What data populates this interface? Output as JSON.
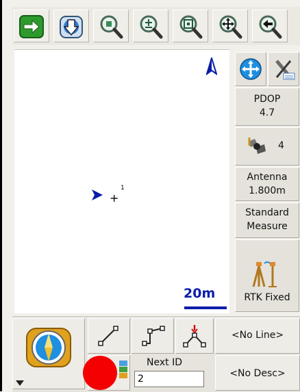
{
  "toolbar": {
    "buttons": [
      {
        "name": "exit-button",
        "icon": "arrow-right-icon"
      },
      {
        "name": "gps-button",
        "icon": "globe-down-arrow-icon"
      },
      {
        "name": "zoom-center-button",
        "icon": "zoom-center-icon"
      },
      {
        "name": "zoom-in-out-button",
        "icon": "zoom-plus-minus-icon"
      },
      {
        "name": "zoom-extents-button",
        "icon": "zoom-extents-icon"
      },
      {
        "name": "pan-button",
        "icon": "pan-cross-icon"
      },
      {
        "name": "back-button",
        "icon": "arrow-left-icon"
      }
    ]
  },
  "map": {
    "point_id": "1",
    "scale_label": "20m"
  },
  "right_panel": {
    "pdop_label": "PDOP",
    "pdop_value": "4.7",
    "satellites": "4",
    "antenna_label": "Antenna",
    "antenna_value": "1.800m",
    "method_line1": "Standard",
    "method_line2": "Measure",
    "rtk_status": "RTK Fixed"
  },
  "bottom": {
    "next_id_label": "Next ID",
    "next_id_value": "2",
    "line_button": "<No Line>",
    "desc_button": "<No Desc>"
  },
  "colors": {
    "accent_blue": "#0a1ca8",
    "record_red": "#f40000",
    "exit_green": "#2e9a2e"
  }
}
